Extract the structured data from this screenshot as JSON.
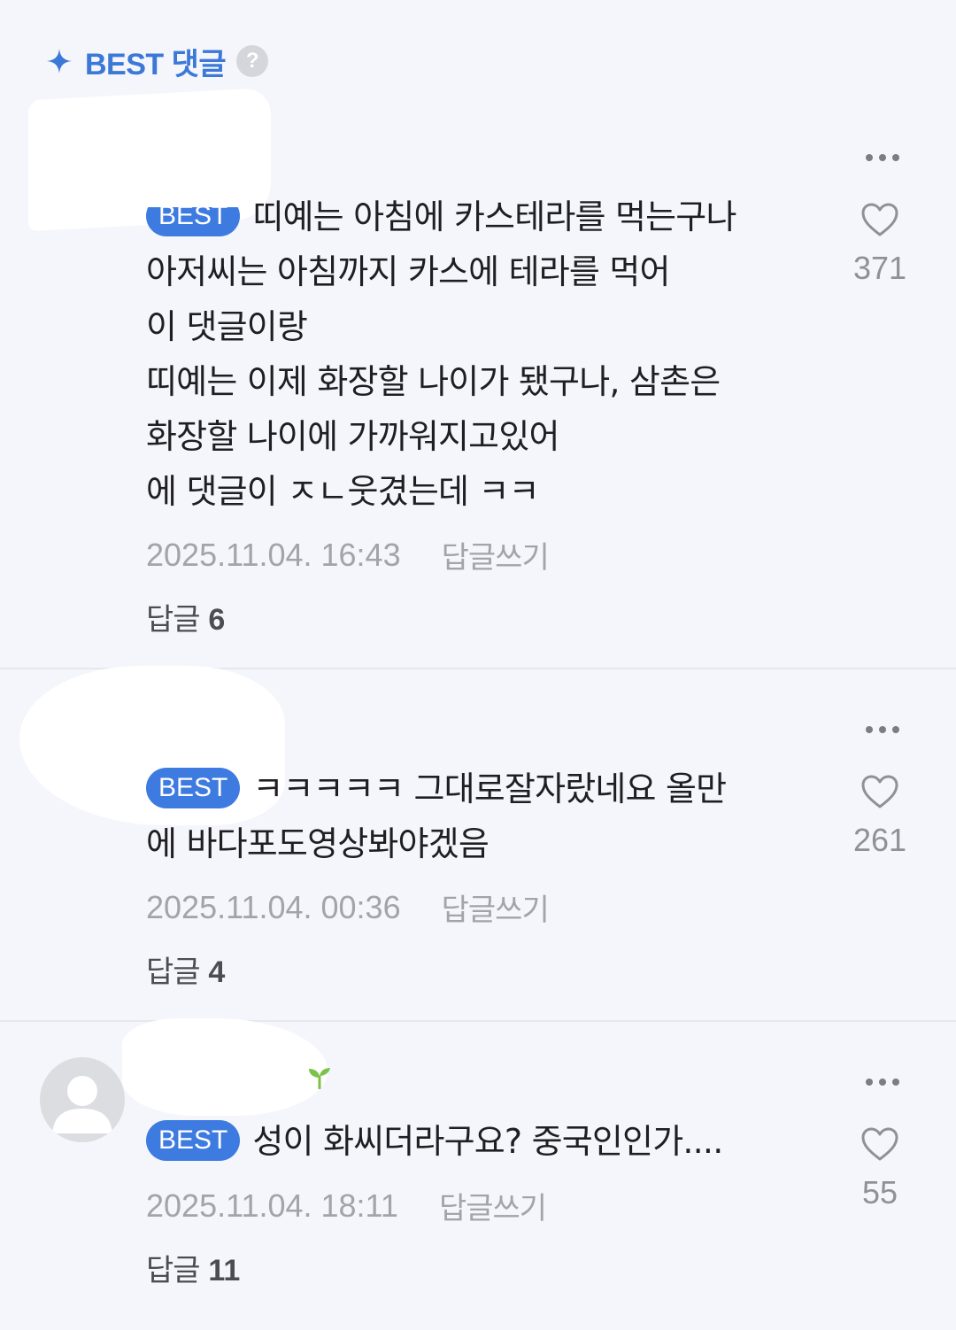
{
  "header": {
    "title": "BEST 댓글",
    "help_label": "?",
    "accent": "#3b78d8"
  },
  "badge_label": "BEST",
  "write_reply_label": "답글쓰기",
  "comments": [
    {
      "lines": [
        "띠예는 아침에 카스테라를 먹는구나",
        "아저씨는 아침까지 카스에 테라를 먹어",
        "이 댓글이랑",
        "띠예는 이제 화장할 나이가 됐구나, 삼촌은",
        "화장할 나이에 가까워지고있어",
        "에 댓글이 ㅈㄴ웃겼는데 ㅋㅋ"
      ],
      "likes": "371",
      "timestamp": "2025.11.04. 16:43",
      "replies_label": "답글",
      "replies_count": "6"
    },
    {
      "lines": [
        "ㅋㅋㅋㅋㅋ 그대로잘자랐네요 올만",
        "에 바다포도영상봐야겠음"
      ],
      "likes": "261",
      "timestamp": "2025.11.04. 00:36",
      "replies_label": "답글",
      "replies_count": "4"
    },
    {
      "lines": [
        "성이 화씨더라구요? 중국인인가...."
      ],
      "likes": "55",
      "timestamp": "2025.11.04. 18:11",
      "replies_label": "답글",
      "replies_count": "11"
    }
  ]
}
